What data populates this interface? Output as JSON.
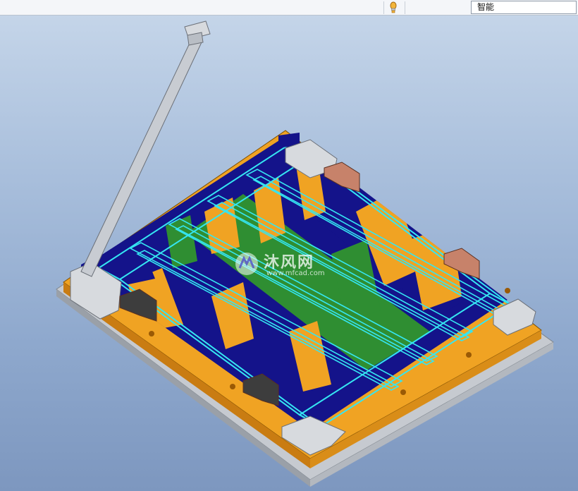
{
  "toolbar": {
    "filter_value": "智能"
  },
  "watermark": {
    "title": "沐风网",
    "url": "www.mfcad.com"
  },
  "icons": [
    "light-bulb-icon",
    "mfcad-logo-icon"
  ],
  "colors": {
    "plate_orange": "#f0a323",
    "base_gray": "#c6cad0",
    "insert_blue": "#14138a",
    "insert_green": "#2f8e32",
    "highlight_cyan": "#35e6f2",
    "clamp_gray": "#d7dade",
    "pad_copper": "#c7826a"
  }
}
